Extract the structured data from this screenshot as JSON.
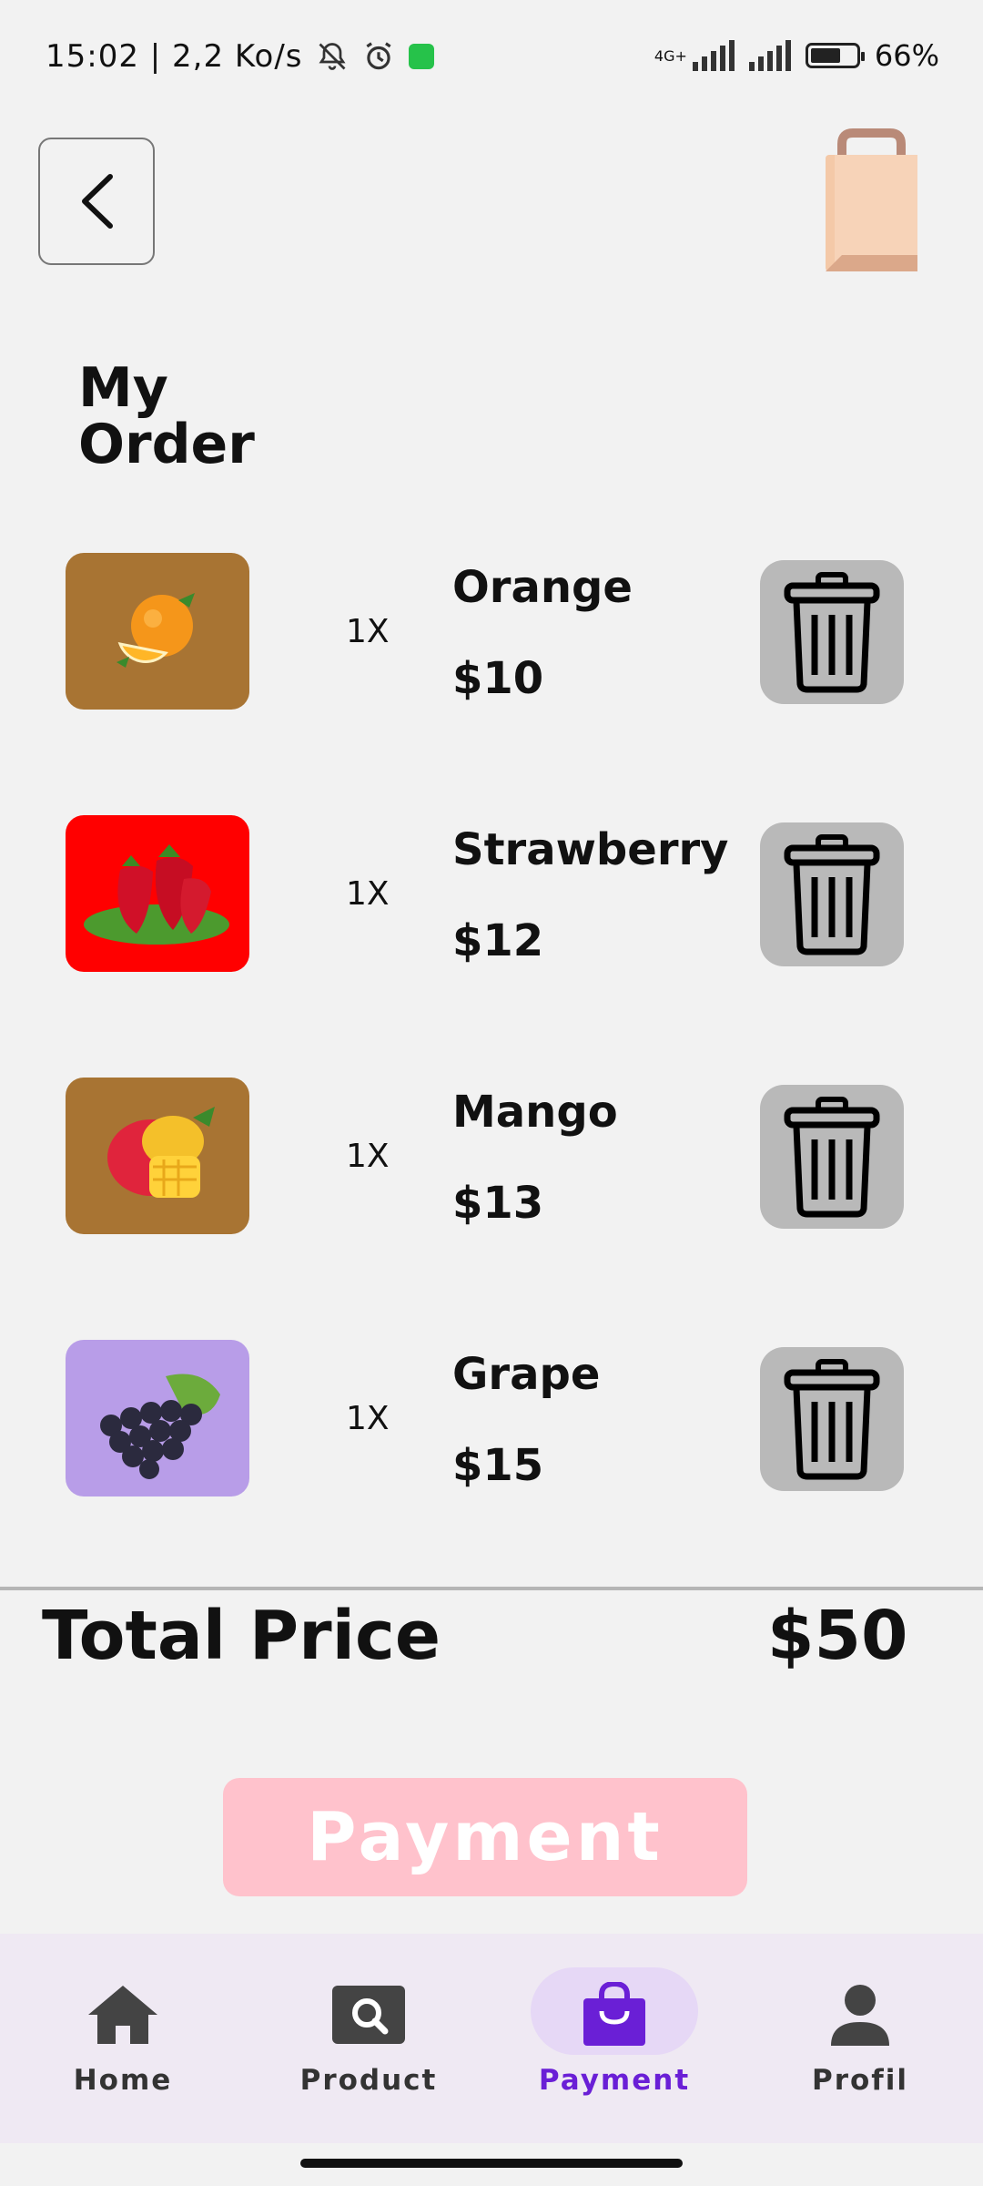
{
  "status_bar": {
    "time_speed": "15:02 | 2,2 Ko/s",
    "network_label": "4G+",
    "battery_text": "66%",
    "battery_level": 0.66
  },
  "header": {
    "page_title": "My Order"
  },
  "orders": [
    {
      "name": "Orange",
      "quantity": "1X",
      "price": "$10",
      "thumb_color": "#a87433",
      "fruit": "orange"
    },
    {
      "name": "Strawberry",
      "quantity": "1X",
      "price": "$12",
      "thumb_color": "#ff0000",
      "fruit": "strawberry"
    },
    {
      "name": "Mango",
      "quantity": "1X",
      "price": "$13",
      "thumb_color": "#a87433",
      "fruit": "mango"
    },
    {
      "name": "Grape",
      "quantity": "1X",
      "price": "$15",
      "thumb_color": "#b89de8",
      "fruit": "grape"
    }
  ],
  "summary": {
    "total_label": "Total Price",
    "total_value": "$50"
  },
  "payment_button_label": "Payment",
  "nav": [
    {
      "label": "Home",
      "icon": "home-icon",
      "active": false
    },
    {
      "label": "Product",
      "icon": "search-icon",
      "active": false
    },
    {
      "label": "Payment",
      "icon": "shopping-bag-icon",
      "active": true
    },
    {
      "label": "Profil",
      "icon": "person-icon",
      "active": false
    }
  ],
  "colors": {
    "background": "#f2f2f2",
    "delete_button": "#b9b9b9",
    "payment_button": "#ffc2cc",
    "nav_background": "#efe9f3",
    "nav_active": "#6a1fd6",
    "nav_active_pill": "#e6d8f6"
  }
}
